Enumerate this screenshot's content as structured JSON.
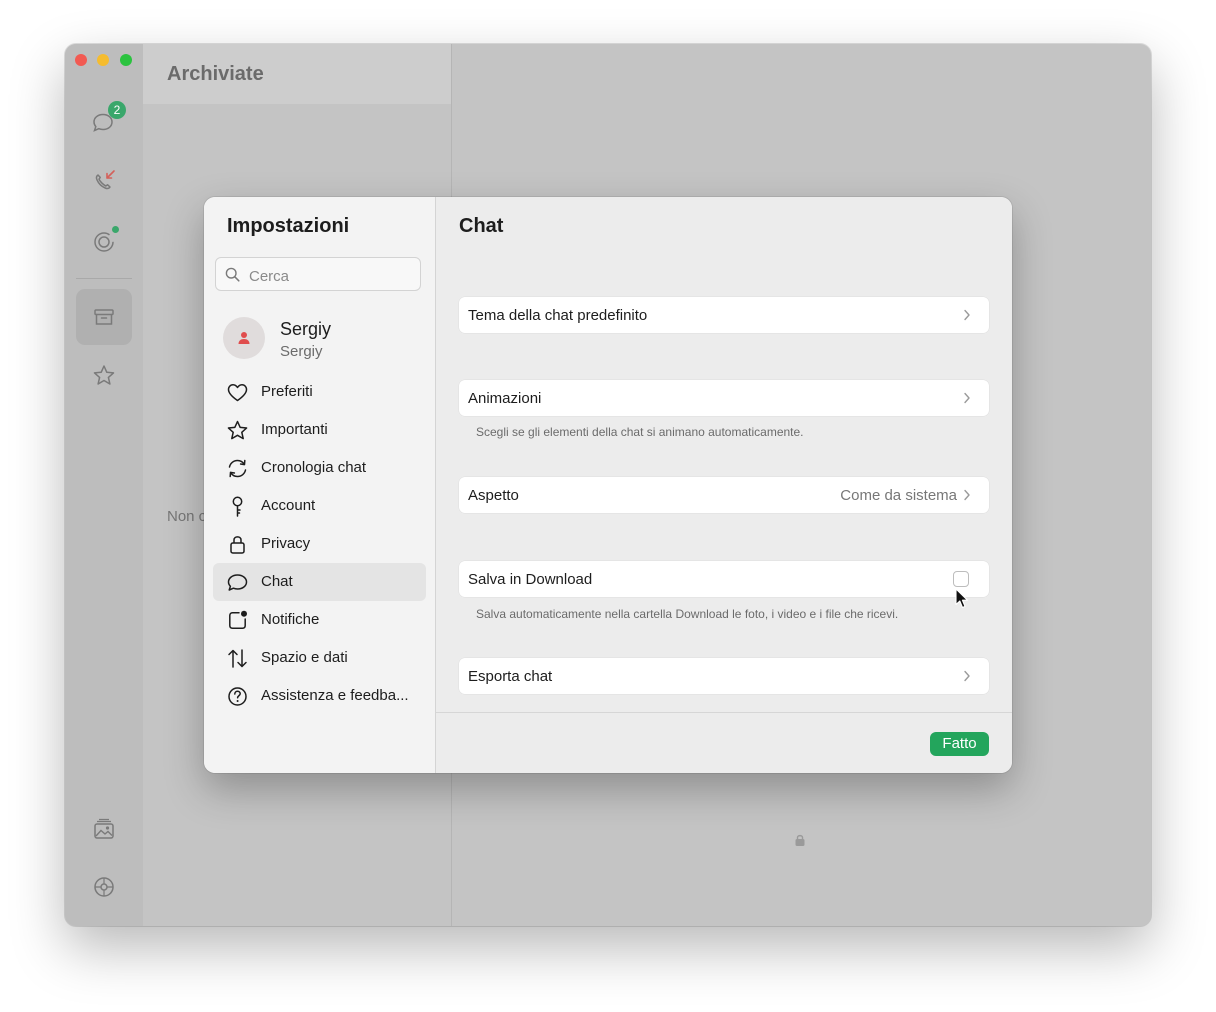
{
  "background_app": {
    "chatlist_title": "Archiviate",
    "chatlist_empty_text": "Non c",
    "chats_unread_count": "2",
    "accent_color": "#3aa76b"
  },
  "settings": {
    "title": "Impostazioni",
    "search": {
      "placeholder": "Cerca",
      "value": ""
    },
    "profile": {
      "name": "Sergiy",
      "subtitle": "Sergiy"
    },
    "nav": [
      {
        "label": "Preferiti",
        "icon": "heart-icon"
      },
      {
        "label": "Importanti",
        "icon": "star-icon"
      },
      {
        "label": "Cronologia chat",
        "icon": "sync-icon"
      },
      {
        "label": "Account",
        "icon": "key-icon"
      },
      {
        "label": "Privacy",
        "icon": "lock-icon"
      },
      {
        "label": "Chat",
        "icon": "chat-bubble-icon",
        "active": true
      },
      {
        "label": "Notifiche",
        "icon": "notification-icon"
      },
      {
        "label": "Spazio e dati",
        "icon": "arrows-updown-icon"
      },
      {
        "label": "Assistenza e feedba...",
        "icon": "help-icon"
      }
    ]
  },
  "chat_settings": {
    "title": "Chat",
    "rows": [
      {
        "label": "Tema della chat predefinito"
      },
      {
        "label": "Animazioni",
        "description": "Scegli se gli elementi della chat si animano automaticamente."
      },
      {
        "label": "Aspetto",
        "value": "Come da sistema"
      },
      {
        "label": "Salva in Download",
        "checked": false,
        "description": "Salva automaticamente nella cartella Download le foto, i video e i file che ricevi."
      },
      {
        "label": "Esporta chat"
      }
    ],
    "done_label": "Fatto",
    "done_color": "#23a55c"
  }
}
